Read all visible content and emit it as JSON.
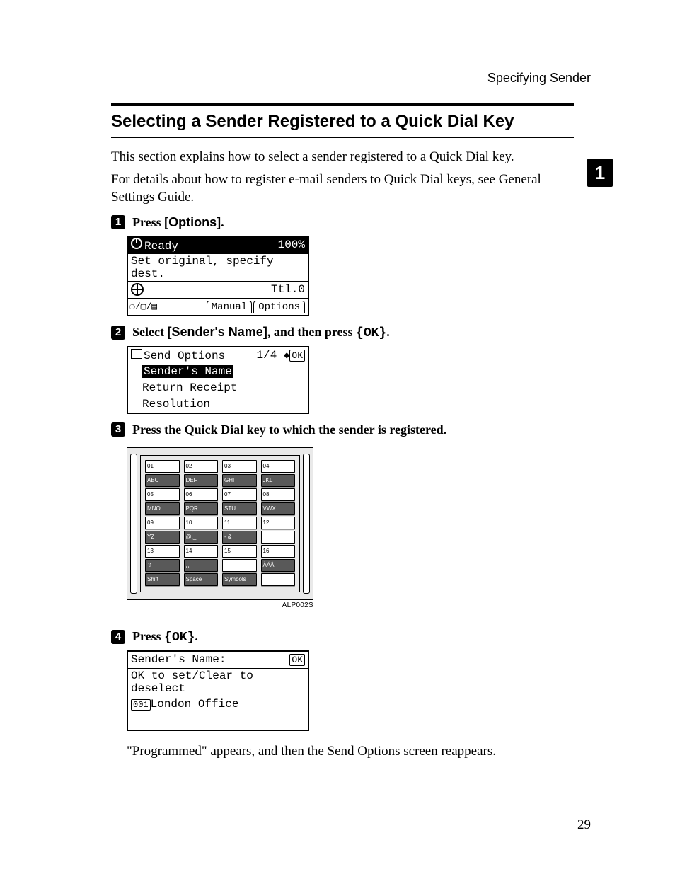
{
  "header": {
    "breadcrumb": "Specifying Sender"
  },
  "chapter": {
    "number": "1"
  },
  "title": "Selecting a Sender Registered to a Quick Dial Key",
  "intro1": "This section explains how to select a sender registered to a Quick Dial key.",
  "intro2": "For details about how to register e-mail senders to Quick Dial keys, see General Settings Guide.",
  "steps": {
    "s1": {
      "num": "1",
      "pre": "Press ",
      "btn": "[Options]",
      "post": "."
    },
    "s2": {
      "num": "2",
      "pre": "Select ",
      "btn": "[Sender's Name]",
      "mid": ", and then press ",
      "key": "{OK}",
      "post": "."
    },
    "s3": {
      "num": "3",
      "text": "Press the Quick Dial key to which the sender is registered."
    },
    "s4": {
      "num": "4",
      "pre": "Press ",
      "key": "{OK}",
      "post": "."
    }
  },
  "lcd1": {
    "status": "Ready",
    "pct": "100%",
    "line2": "Set original, specify dest.",
    "total": "Ttl.0",
    "tab_manual": "Manual",
    "tab_options": "Options"
  },
  "lcd2": {
    "title": "Send Options",
    "page": "1/4",
    "ok": "OK",
    "sel": "Sender's Name",
    "opt2": "Return Receipt",
    "opt3": "Resolution"
  },
  "keypad": {
    "rows": [
      [
        "01",
        "02",
        "03",
        "04"
      ],
      [
        "ABC",
        "DEF",
        "GHI",
        "JKL"
      ],
      [
        "05",
        "06",
        "07",
        "08"
      ],
      [
        "MNO",
        "PQR",
        "STU",
        "VWX"
      ],
      [
        "09",
        "10",
        "11",
        "12"
      ],
      [
        "YZ",
        "@._",
        "- &",
        ""
      ],
      [
        "13",
        "14",
        "15",
        "16"
      ],
      [
        "⇧",
        "␣",
        "",
        "ÀÁÂ"
      ],
      [
        "Shift",
        "Space",
        "Symbols",
        ""
      ]
    ],
    "img_id": "ALP002S"
  },
  "lcd4": {
    "title": "Sender's Name:",
    "ok": "OK",
    "help": "OK to set/Clear to deselect",
    "code": "001",
    "value": "London Office"
  },
  "result": "\"Programmed\" appears, and then the Send Options screen reappears.",
  "page_number": "29"
}
